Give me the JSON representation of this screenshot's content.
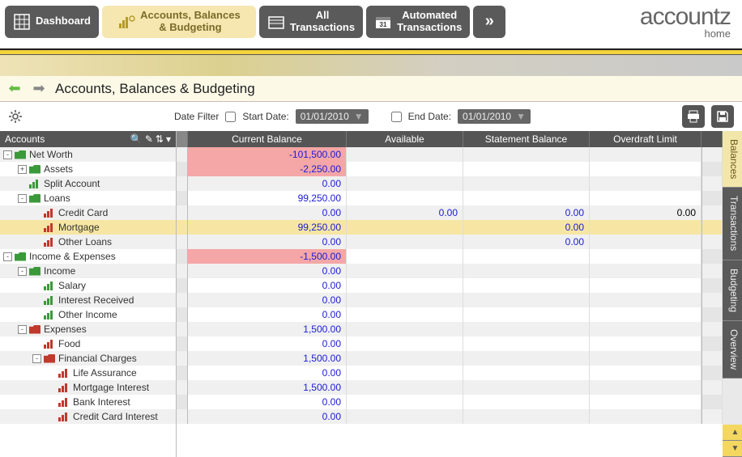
{
  "nav": {
    "dashboard": "Dashboard",
    "accounts": "Accounts, Balances\n& Budgeting",
    "all_tx": "All\nTransactions",
    "auto_tx": "Automated\nTransactions"
  },
  "logo": {
    "brand": "accountz",
    "sub": "home"
  },
  "page_title": "Accounts, Balances & Budgeting",
  "filter": {
    "label": "Date Filter",
    "start_label": "Start Date:",
    "end_label": "End Date:",
    "start_date": "01/01/2010",
    "end_date": "01/01/2010"
  },
  "tree_header": "Accounts",
  "columns": {
    "cb": "Current Balance",
    "av": "Available",
    "sb": "Statement Balance",
    "ol": "Overdraft Limit"
  },
  "side_tabs": {
    "balances": "Balances",
    "transactions": "Transactions",
    "budgeting": "Budgeting",
    "overview": "Overview"
  },
  "rows": [
    {
      "label": "Net Worth",
      "depth": 0,
      "exp": "-",
      "icon": "fold-green",
      "cb": "-101,500.00",
      "neg": true,
      "av": "",
      "sb": "",
      "ol": ""
    },
    {
      "label": "Assets",
      "depth": 1,
      "exp": "+",
      "icon": "fold-green",
      "cb": "-2,250.00",
      "neg": true,
      "av": "",
      "sb": "",
      "ol": ""
    },
    {
      "label": "Split Account",
      "depth": 1,
      "exp": "",
      "icon": "bars-green",
      "cb": "0.00",
      "av": "",
      "sb": "",
      "ol": ""
    },
    {
      "label": "Loans",
      "depth": 1,
      "exp": "-",
      "icon": "fold-green",
      "cb": "99,250.00",
      "av": "",
      "sb": "",
      "ol": ""
    },
    {
      "label": "Credit Card",
      "depth": 2,
      "exp": "",
      "icon": "bars-red",
      "cb": "0.00",
      "av": "0.00",
      "sb": "0.00",
      "ol": "0.00"
    },
    {
      "label": "Mortgage",
      "depth": 2,
      "exp": "",
      "icon": "bars-red",
      "cb": "99,250.00",
      "av": "",
      "sb": "0.00",
      "ol": "",
      "sel": true
    },
    {
      "label": "Other Loans",
      "depth": 2,
      "exp": "",
      "icon": "bars-red",
      "cb": "0.00",
      "av": "",
      "sb": "0.00",
      "ol": ""
    },
    {
      "label": "Income & Expenses",
      "depth": 0,
      "exp": "-",
      "icon": "fold-green",
      "cb": "-1,500.00",
      "neg": true,
      "av": "",
      "sb": "",
      "ol": ""
    },
    {
      "label": "Income",
      "depth": 1,
      "exp": "-",
      "icon": "fold-green",
      "cb": "0.00",
      "av": "",
      "sb": "",
      "ol": ""
    },
    {
      "label": "Salary",
      "depth": 2,
      "exp": "",
      "icon": "bars-green",
      "cb": "0.00",
      "av": "",
      "sb": "",
      "ol": ""
    },
    {
      "label": "Interest Received",
      "depth": 2,
      "exp": "",
      "icon": "bars-green",
      "cb": "0.00",
      "av": "",
      "sb": "",
      "ol": ""
    },
    {
      "label": "Other Income",
      "depth": 2,
      "exp": "",
      "icon": "bars-green",
      "cb": "0.00",
      "av": "",
      "sb": "",
      "ol": ""
    },
    {
      "label": "Expenses",
      "depth": 1,
      "exp": "-",
      "icon": "fold-red",
      "cb": "1,500.00",
      "av": "",
      "sb": "",
      "ol": ""
    },
    {
      "label": "Food",
      "depth": 2,
      "exp": "",
      "icon": "bars-red",
      "cb": "0.00",
      "av": "",
      "sb": "",
      "ol": ""
    },
    {
      "label": "Financial Charges",
      "depth": 2,
      "exp": "-",
      "icon": "fold-red",
      "cb": "1,500.00",
      "av": "",
      "sb": "",
      "ol": ""
    },
    {
      "label": "Life Assurance",
      "depth": 3,
      "exp": "",
      "icon": "bars-red",
      "cb": "0.00",
      "av": "",
      "sb": "",
      "ol": ""
    },
    {
      "label": "Mortgage Interest",
      "depth": 3,
      "exp": "",
      "icon": "bars-red",
      "cb": "1,500.00",
      "av": "",
      "sb": "",
      "ol": ""
    },
    {
      "label": "Bank Interest",
      "depth": 3,
      "exp": "",
      "icon": "bars-red",
      "cb": "0.00",
      "av": "",
      "sb": "",
      "ol": ""
    },
    {
      "label": "Credit Card Interest",
      "depth": 3,
      "exp": "",
      "icon": "bars-red",
      "cb": "0.00",
      "av": "",
      "sb": "",
      "ol": ""
    }
  ]
}
